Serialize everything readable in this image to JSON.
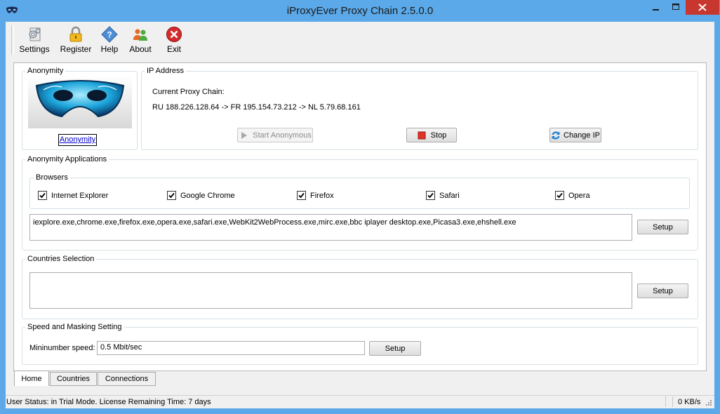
{
  "window": {
    "title": "iProxyEver Proxy Chain 2.5.0.0"
  },
  "toolbar": {
    "items": [
      {
        "label": "Settings",
        "icon": "settings-icon"
      },
      {
        "label": "Register",
        "icon": "padlock-icon"
      },
      {
        "label": "Help",
        "icon": "help-diamond-icon"
      },
      {
        "label": "About",
        "icon": "people-icon"
      },
      {
        "label": "Exit",
        "icon": "close-circle-icon"
      }
    ]
  },
  "anonymity": {
    "title": "Anonymity",
    "link": "Anonymity"
  },
  "ip_address": {
    "title": "IP Address",
    "chain_label": "Current Proxy Chain:",
    "chain_value": "RU 188.226.128.64 -> FR 195.154.73.212 -> NL 5.79.68.161",
    "start_label": "Start Anonymous",
    "stop_label": "Stop",
    "change_ip_label": "Change IP"
  },
  "applications": {
    "title": "Anonymity Applications",
    "browsers_title": "Browsers",
    "browsers": [
      {
        "label": "Internet Explorer",
        "checked": true
      },
      {
        "label": "Google Chrome",
        "checked": true
      },
      {
        "label": "Firefox",
        "checked": true
      },
      {
        "label": "Safari",
        "checked": true
      },
      {
        "label": "Opera",
        "checked": true
      }
    ],
    "processes": "iexplore.exe,chrome.exe,firefox.exe,opera.exe,safari.exe,WebKit2WebProcess.exe,mirc.exe,bbc iplayer desktop.exe,Picasa3.exe,ehshell.exe",
    "setup_label": "Setup"
  },
  "countries": {
    "title": "Countries Selection",
    "value": "",
    "setup_label": "Setup"
  },
  "speed": {
    "title": "Speed and Masking Setting",
    "label": "Mininumber speed:",
    "value": "0.5 Mbit/sec",
    "setup_label": "Setup"
  },
  "tabs": [
    {
      "label": "Home",
      "active": true
    },
    {
      "label": "Countries",
      "active": false
    },
    {
      "label": "Connections",
      "active": false
    }
  ],
  "status": {
    "text": "User Status:  in Trial Mode. License Remaining Time: 7 days",
    "speed": "0 KB/s"
  },
  "colors": {
    "titlebar": "#5ba9e8",
    "close_button": "#c7372f",
    "mask": "#1aa3d9"
  }
}
